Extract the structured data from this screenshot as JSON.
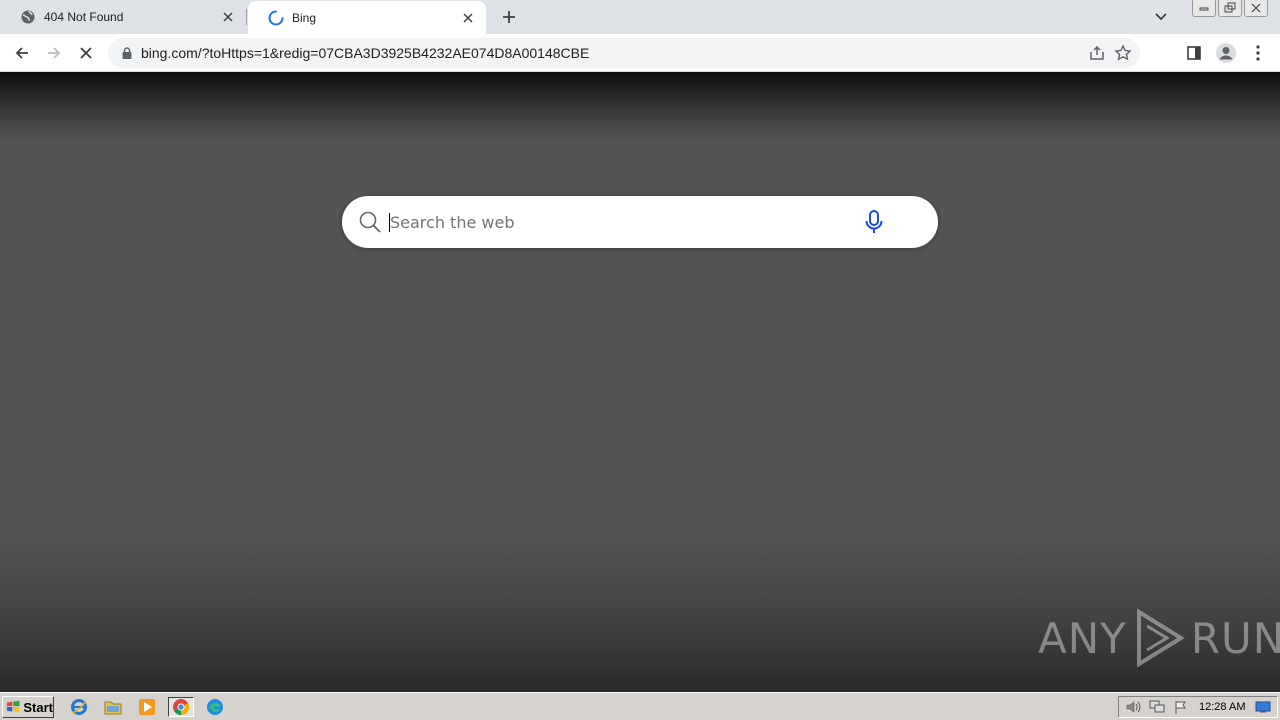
{
  "browser": {
    "tabs": [
      {
        "title": "404 Not Found",
        "favicon": "globe-icon"
      },
      {
        "title": "Bing",
        "favicon": "loading-spinner-icon",
        "active": true
      }
    ],
    "url": "bing.com/?toHttps=1&redig=07CBA3D3925B4232AE074D8A00148CBE"
  },
  "search": {
    "placeholder": "Search the web",
    "value": ""
  },
  "watermark": {
    "left": "ANY",
    "right": "RUN"
  },
  "taskbar": {
    "start_label": "Start",
    "clock": "12:28 AM"
  },
  "colors": {
    "bing_blue": "#174ae4",
    "chrome_tab_bg": "#dee1e6",
    "page_bg": "#545454"
  }
}
